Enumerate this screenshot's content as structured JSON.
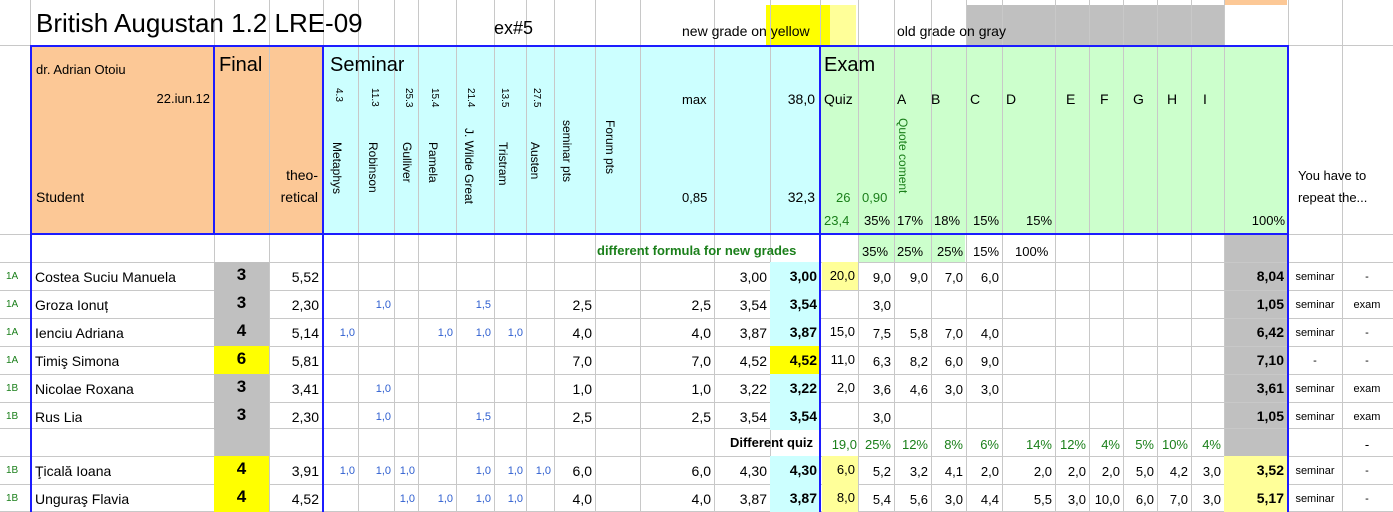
{
  "title": "British Augustan 1.2 LRE-09",
  "ex": "ex#5",
  "legend": {
    "new_grade": "new grade on yellow",
    "old_grade": "old grade on gray"
  },
  "header": {
    "teacher": "dr. Adrian Otoiu",
    "date": "22.iun.12",
    "student": "Student",
    "final": "Final",
    "theoretical": "theo-\nretical",
    "seminar": "Seminar",
    "exam": "Exam",
    "max_label": "max",
    "max_value": "38,0",
    "ratio_label": "0,85",
    "ratio_value": "32,3",
    "quiz": "Quiz",
    "exam_letters": [
      "A",
      "B",
      "C",
      "D",
      "E",
      "F",
      "G",
      "H",
      "I"
    ],
    "quote_coment": "Quote coment",
    "repeat": "You have to\nrepeat the...",
    "seminar_cols": [
      {
        "max": "4.3",
        "name": "Metaphys"
      },
      {
        "max": "11.3",
        "name": "Robinson"
      },
      {
        "max": "25.3",
        "name": "Gulliver"
      },
      {
        "max": "15.4",
        "name": "Pamela"
      },
      {
        "max": "21.4",
        "name": "J. Wilde Great"
      },
      {
        "max": "13.5",
        "name": "Tristram"
      },
      {
        "max": "27.5",
        "name": "Austen"
      },
      {
        "max": "",
        "name": "seminar pts"
      },
      {
        "max": "",
        "name": "Forum pts"
      }
    ],
    "quiz_pts": "26",
    "quiz_ratio": "0,90",
    "weights": [
      "23,4",
      "35%",
      "17%",
      "18%",
      "15%",
      "15%"
    ],
    "hundred": "100%",
    "formula_note": "different formula for new grades",
    "formula_weights": [
      "35%",
      "25%",
      "25%",
      "15%",
      "100%"
    ]
  },
  "rows": [
    {
      "grp": "1A",
      "name": "Costea Suciu Manuela",
      "final": "3",
      "final_color": "gray",
      "theo": "5,52",
      "sem": [
        "",
        "",
        "",
        "",
        "",
        "",
        ""
      ],
      "sp": "",
      "fp": "",
      "tot": "3,00",
      "semg": "3,00",
      "semg_color": "cyan",
      "quiz": "20,0",
      "quiz_color": "yellow",
      "ex": [
        "9,0",
        "9,0",
        "7,0",
        "6,0"
      ],
      "exg": "8,04",
      "r1": "seminar",
      "r2": "-"
    },
    {
      "grp": "1A",
      "name": "Groza Ionuț",
      "final": "3",
      "final_color": "gray",
      "theo": "2,30",
      "sem": [
        "",
        "1,0",
        "",
        "",
        "1,5",
        "",
        ""
      ],
      "sp": "2,5",
      "fp": "2,5",
      "tot": "3,54",
      "semg": "3,54",
      "semg_color": "cyan",
      "quiz": "",
      "quiz_color": "",
      "ex": [
        "3,0",
        "",
        "",
        ""
      ],
      "exg": "1,05",
      "r1": "seminar",
      "r2": "exam"
    },
    {
      "grp": "1A",
      "name": "Ienciu Adriana",
      "final": "4",
      "final_color": "gray",
      "theo": "5,14",
      "sem": [
        "1,0",
        "",
        "",
        "1,0",
        "1,0",
        "1,0",
        ""
      ],
      "sp": "4,0",
      "fp": "4,0",
      "tot": "3,87",
      "semg": "3,87",
      "semg_color": "cyan",
      "quiz": "15,0",
      "quiz_color": "",
      "ex": [
        "7,5",
        "5,8",
        "7,0",
        "4,0"
      ],
      "exg": "6,42",
      "r1": "seminar",
      "r2": "-"
    },
    {
      "grp": "1A",
      "name": "Timiş Simona",
      "final": "6",
      "final_color": "yellow",
      "theo": "5,81",
      "sem": [
        "",
        "",
        "",
        "",
        "",
        "",
        ""
      ],
      "sp": "7,0",
      "fp": "7,0",
      "tot": "4,52",
      "semg": "4,52",
      "semg_color": "yellow",
      "quiz": "11,0",
      "quiz_color": "",
      "ex": [
        "6,3",
        "8,2",
        "6,0",
        "9,0"
      ],
      "exg": "7,10",
      "r1": "-",
      "r2": "-"
    },
    {
      "grp": "1B",
      "name": "Nicolae Roxana",
      "final": "3",
      "final_color": "gray",
      "theo": "3,41",
      "sem": [
        "",
        "1,0",
        "",
        "",
        "",
        "",
        ""
      ],
      "sp": "1,0",
      "fp": "1,0",
      "tot": "3,22",
      "semg": "3,22",
      "semg_color": "cyan",
      "quiz": "2,0",
      "quiz_color": "",
      "ex": [
        "3,6",
        "4,6",
        "3,0",
        "3,0"
      ],
      "exg": "3,61",
      "r1": "seminar",
      "r2": "exam"
    },
    {
      "grp": "1B",
      "name": "Rus Lia",
      "final": "3",
      "final_color": "gray",
      "theo": "2,30",
      "sem": [
        "",
        "1,0",
        "",
        "",
        "1,5",
        "",
        ""
      ],
      "sp": "2,5",
      "fp": "2,5",
      "tot": "3,54",
      "semg": "3,54",
      "semg_color": "cyan",
      "quiz": "",
      "quiz_color": "",
      "ex": [
        "3,0",
        "",
        "",
        ""
      ],
      "exg": "1,05",
      "r1": "seminar",
      "r2": "exam"
    }
  ],
  "diff_quiz": {
    "label": "Different quiz",
    "weights": [
      "19,0",
      "25%",
      "12%",
      "8%",
      "6%",
      "14%",
      "12%",
      "4%",
      "5%",
      "10%",
      "4%"
    ],
    "r2": "-"
  },
  "rows2": [
    {
      "grp": "1B",
      "name": "Ţicală Ioana",
      "final": "4",
      "theo": "3,91",
      "sem": [
        "1,0",
        "1,0",
        "1,0",
        "",
        "1,0",
        "1,0",
        "1,0"
      ],
      "sp": "6,0",
      "fp": "6,0",
      "tot": "4,30",
      "semg": "4,30",
      "quiz": "6,0",
      "ex": [
        "5,2",
        "3,2",
        "4,1",
        "2,0",
        "2,0",
        "2,0",
        "2,0",
        "5,0",
        "4,2",
        "3,0"
      ],
      "exg": "3,52",
      "r1": "seminar",
      "r2": "-"
    },
    {
      "grp": "1B",
      "name": "Unguraş Flavia",
      "final": "4",
      "theo": "4,52",
      "sem": [
        "",
        "",
        "1,0",
        "1,0",
        "1,0",
        "1,0",
        ""
      ],
      "sp": "4,0",
      "fp": "4,0",
      "tot": "3,87",
      "semg": "3,87",
      "quiz": "8,0",
      "ex": [
        "5,4",
        "5,6",
        "3,0",
        "4,4",
        "5,5",
        "3,0",
        "10,0",
        "6,0",
        "7,0",
        "3,0"
      ],
      "exg": "5,17",
      "r1": "seminar",
      "r2": "-"
    }
  ],
  "colors": {
    "orange": "#fcc896",
    "cyan": "#ccffff",
    "green": "#ccffcc",
    "yellow": "#ffff00",
    "lightyellow": "#ffff99",
    "gray": "#c0c0c0",
    "border": "#1c1cff"
  }
}
